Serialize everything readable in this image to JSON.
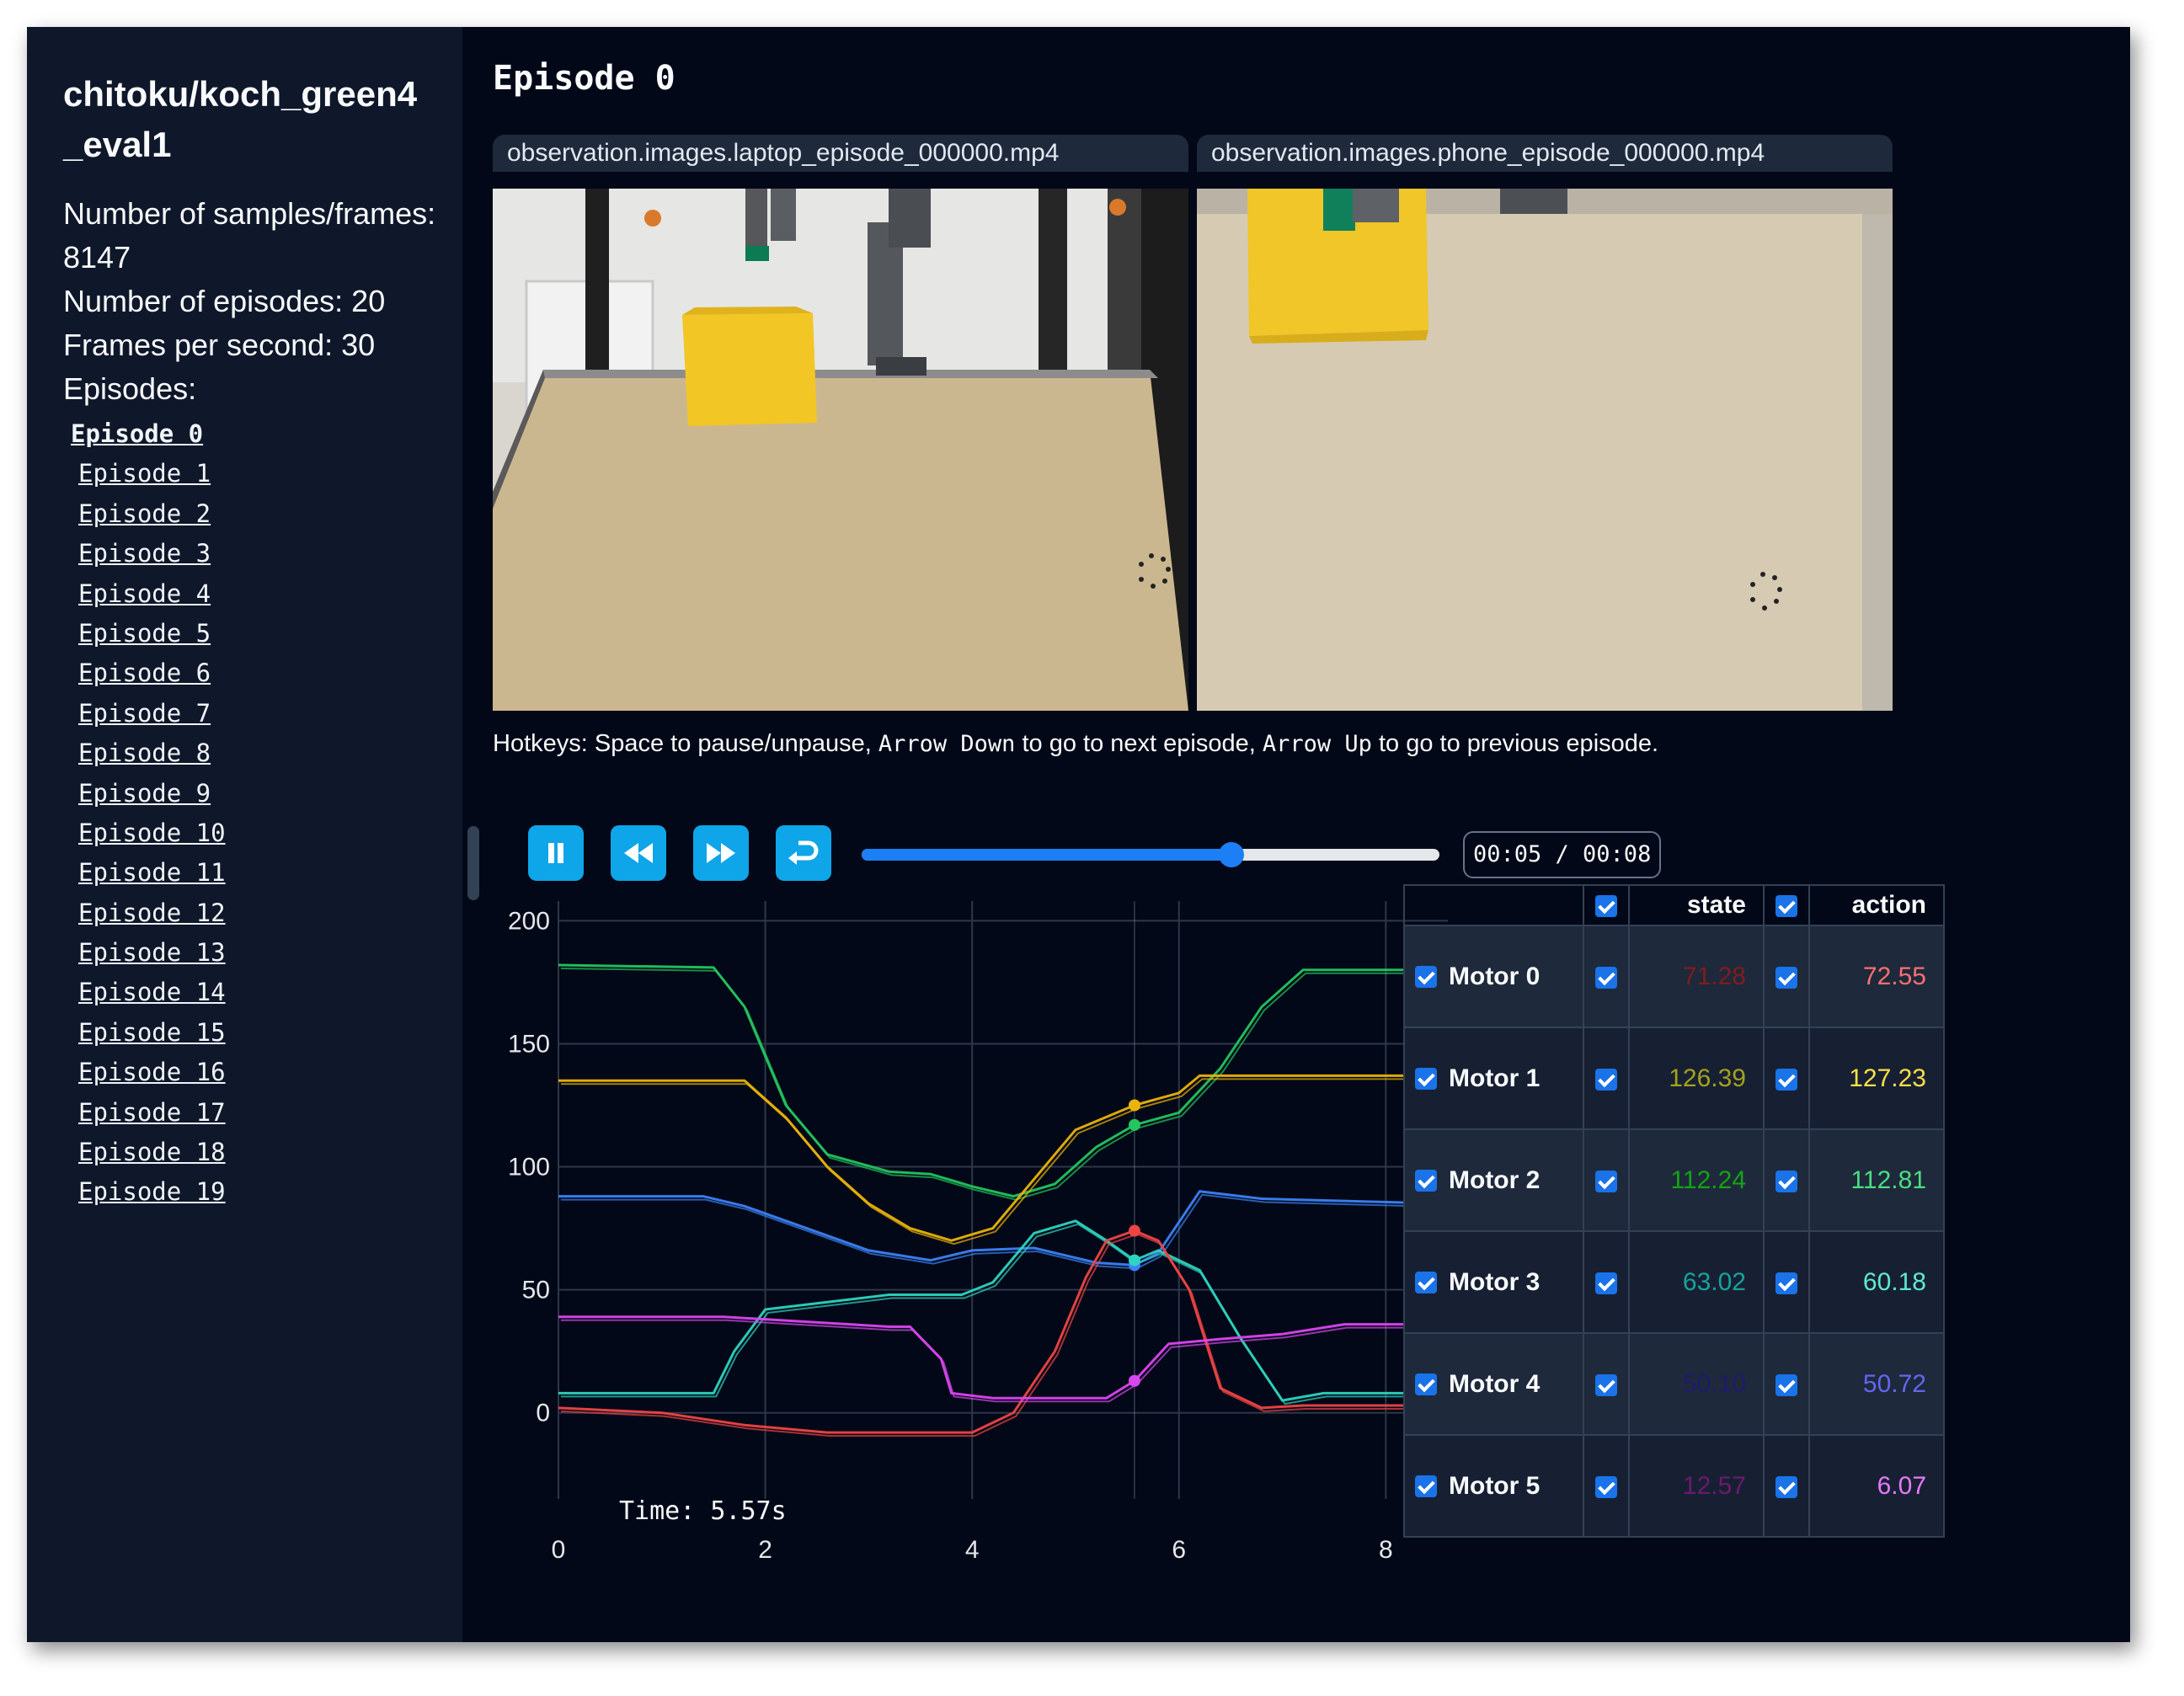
{
  "sidebar": {
    "dataset_title": "chitoku/koch_green4_eval1",
    "samples_label": "Number of samples/frames:",
    "samples_value": "8147",
    "episodes_count": "Number of episodes: 20",
    "fps": "Frames per second: 30",
    "episodes_label": "Episodes:",
    "episodes": [
      "Episode 0",
      "Episode 1",
      "Episode 2",
      "Episode 3",
      "Episode 4",
      "Episode 5",
      "Episode 6",
      "Episode 7",
      "Episode 8",
      "Episode 9",
      "Episode 10",
      "Episode 11",
      "Episode 12",
      "Episode 13",
      "Episode 14",
      "Episode 15",
      "Episode 16",
      "Episode 17",
      "Episode 18",
      "Episode 19"
    ],
    "active_episode": 0
  },
  "main": {
    "title": "Episode 0",
    "videos": [
      {
        "label": "observation.images.laptop_episode_000000.mp4"
      },
      {
        "label": "observation.images.phone_episode_000000.mp4"
      }
    ],
    "hotkeys": {
      "part1": "Hotkeys: Space to pause/unpause, ",
      "key1": "Arrow Down",
      "part2": " to go to next episode, ",
      "key2": "Arrow Up",
      "part3": " to go to previous episode."
    },
    "player": {
      "time_display": "00:05 / 00:08",
      "progress": 0.64,
      "buttons": [
        "pause-icon",
        "rewind-icon",
        "fast-forward-icon",
        "restart-icon"
      ]
    },
    "time_readout": "Time: 5.57s"
  },
  "table": {
    "headers": {
      "state": "state",
      "action": "action"
    },
    "rows": [
      {
        "motor": "Motor 0",
        "state": "71.28",
        "action": "72.55",
        "state_color": "#7f1d1d",
        "action_color": "#f87171"
      },
      {
        "motor": "Motor 1",
        "state": "126.39",
        "action": "127.23",
        "state_color": "#a3a31a",
        "action_color": "#fde047"
      },
      {
        "motor": "Motor 2",
        "state": "112.24",
        "action": "112.81",
        "state_color": "#15a315",
        "action_color": "#4ade80"
      },
      {
        "motor": "Motor 3",
        "state": "63.02",
        "action": "60.18",
        "state_color": "#16a39a",
        "action_color": "#5eead4"
      },
      {
        "motor": "Motor 4",
        "state": "50.10",
        "action": "50.72",
        "state_color": "#1e1b6b",
        "action_color": "#6366f1"
      },
      {
        "motor": "Motor 5",
        "state": "12.57",
        "action": "6.07",
        "state_color": "#6b1a6b",
        "action_color": "#e879f9"
      }
    ]
  },
  "chart_data": {
    "type": "line",
    "xlim": [
      0,
      8.6
    ],
    "ylim": [
      -35,
      208
    ],
    "xticks": [
      0,
      2,
      4,
      6,
      8
    ],
    "yticks": [
      0,
      50,
      100,
      150,
      200
    ],
    "grid": true,
    "cursor_x": 5.57,
    "series": [
      {
        "color": "#22c55e",
        "x": [
          0,
          1.5,
          1.8,
          2.2,
          2.6,
          3.2,
          3.6,
          4.0,
          4.4,
          4.8,
          5.2,
          5.57,
          6.0,
          6.4,
          6.8,
          7.2,
          8.6
        ],
        "y": [
          182,
          181,
          165,
          125,
          105,
          98,
          97,
          92,
          88,
          93,
          108,
          117,
          122,
          140,
          165,
          180,
          180
        ]
      },
      {
        "color": "#eab308",
        "x": [
          0,
          1.8,
          2.2,
          2.6,
          3.0,
          3.4,
          3.8,
          4.2,
          4.6,
          5.0,
          5.57,
          6.0,
          6.2,
          6.6,
          8.6
        ],
        "y": [
          135,
          135,
          120,
          100,
          85,
          75,
          70,
          75,
          95,
          115,
          125,
          130,
          137,
          137,
          137
        ]
      },
      {
        "color": "#3b82f6",
        "x": [
          0,
          1.4,
          1.8,
          2.4,
          3.0,
          3.6,
          4.0,
          4.6,
          5.2,
          5.57,
          5.8,
          6.2,
          6.8,
          8.6
        ],
        "y": [
          88,
          88,
          84,
          75,
          66,
          62,
          66,
          67,
          61,
          60,
          65,
          90,
          87,
          85
        ]
      },
      {
        "color": "#2dd4bf",
        "x": [
          0,
          1.5,
          1.7,
          2.0,
          2.6,
          3.2,
          3.6,
          3.9,
          4.2,
          4.6,
          5.0,
          5.3,
          5.57,
          5.8,
          6.2,
          6.6,
          7.0,
          7.4,
          8.6
        ],
        "y": [
          8,
          8,
          25,
          42,
          45,
          48,
          48,
          48,
          53,
          73,
          78,
          70,
          62,
          66,
          58,
          30,
          5,
          8,
          8
        ]
      },
      {
        "color": "#ef4444",
        "x": [
          0,
          1.0,
          1.8,
          2.6,
          3.4,
          4.0,
          4.4,
          4.8,
          5.1,
          5.3,
          5.57,
          5.8,
          6.1,
          6.4,
          6.8,
          7.2,
          8.6
        ],
        "y": [
          2,
          0,
          -5,
          -8,
          -8,
          -8,
          0,
          25,
          55,
          70,
          74,
          70,
          50,
          10,
          2,
          3,
          3
        ]
      },
      {
        "color": "#d946ef",
        "x": [
          0,
          1.6,
          2.4,
          3.2,
          3.4,
          3.7,
          3.8,
          4.2,
          4.8,
          5.3,
          5.57,
          5.9,
          6.4,
          7.0,
          7.6,
          8.6
        ],
        "y": [
          39,
          39,
          37,
          35,
          35,
          22,
          8,
          6,
          6,
          6,
          13,
          28,
          30,
          32,
          36,
          36
        ]
      }
    ]
  }
}
